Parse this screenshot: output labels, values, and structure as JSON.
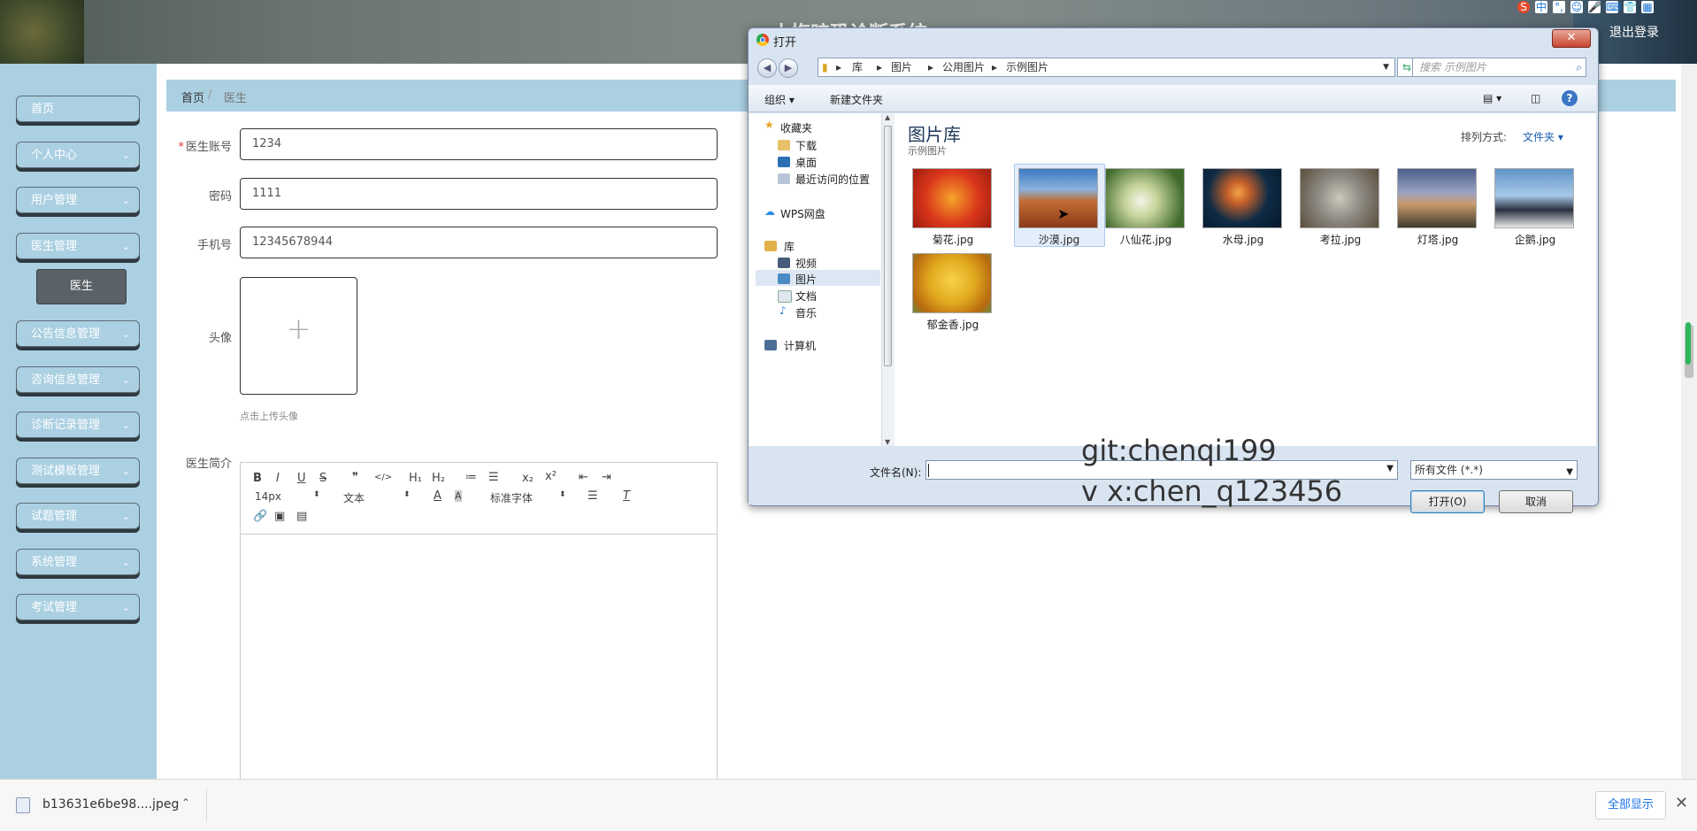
{
  "header": {
    "title": "小梅暗恐诊断系统",
    "logout": "退出登录",
    "ime_icons": [
      "S",
      "中",
      "°,",
      "☺",
      "🎤",
      "⌨",
      "👕",
      "▦"
    ]
  },
  "sidebar": {
    "items": [
      {
        "label": "首页",
        "has_chevron": false
      },
      {
        "label": "个人中心",
        "has_chevron": true
      },
      {
        "label": "用户管理",
        "has_chevron": true
      },
      {
        "label": "医生管理",
        "has_chevron": true
      },
      {
        "label": "公告信息管理",
        "has_chevron": true
      },
      {
        "label": "咨询信息管理",
        "has_chevron": true
      },
      {
        "label": "诊断记录管理",
        "has_chevron": true
      },
      {
        "label": "测试模板管理",
        "has_chevron": true
      },
      {
        "label": "试题管理",
        "has_chevron": true
      },
      {
        "label": "系统管理",
        "has_chevron": true
      },
      {
        "label": "考试管理",
        "has_chevron": true
      }
    ],
    "sub_item": "医生"
  },
  "breadcrumb": {
    "home": "首页",
    "separator": "/",
    "current": "医生"
  },
  "form": {
    "account_label": "医生账号",
    "account_required_mark": "*",
    "account_value": "1234",
    "password_label": "密码",
    "password_value": "1111",
    "phone_label": "手机号",
    "phone_value": "12345678944",
    "avatar_label": "头像",
    "upload_plus": "+",
    "upload_hint": "点击上传头像",
    "intro_label": "医生简介"
  },
  "editor": {
    "row1": [
      "B",
      "I",
      "U",
      "S",
      "❞",
      "</>",
      "H₁",
      "H₂",
      "≔",
      "☰",
      "x₂",
      "x²",
      "⇤",
      "⇥"
    ],
    "font_size": "14px",
    "text_type": "文本",
    "font_family": "标准字体",
    "row3_icons": [
      "link-icon",
      "image-icon",
      "video-icon"
    ]
  },
  "dialog": {
    "title": "打开",
    "close": "✕",
    "path": [
      "库",
      "图片",
      "公用图片",
      "示例图片"
    ],
    "search_placeholder": "搜索 示例图片",
    "organize": "组织 ▾",
    "new_folder": "新建文件夹",
    "tree": {
      "favorites": "收藏夹",
      "downloads": "下载",
      "desktop": "桌面",
      "recent": "最近访问的位置",
      "wps": "WPS网盘",
      "library": "库",
      "videos": "视频",
      "pictures": "图片",
      "documents": "文档",
      "music": "音乐",
      "computer": "计算机"
    },
    "library_title": "图片库",
    "library_sub": "示例图片",
    "arrange_label": "排列方式:",
    "arrange_value": "文件夹 ▾",
    "files": [
      {
        "name": "菊花.jpg",
        "color": "#d9361b"
      },
      {
        "name": "沙漠.jpg",
        "color": "#a34f2a"
      },
      {
        "name": "八仙花.jpg",
        "color": "#7d9a4c"
      },
      {
        "name": "水母.jpg",
        "color": "#15334d"
      },
      {
        "name": "考拉.jpg",
        "color": "#8d8a82"
      },
      {
        "name": "灯塔.jpg",
        "color": "#6a6e85"
      },
      {
        "name": "企鹅.jpg",
        "color": "#4d7fb0"
      },
      {
        "name": "郁金香.jpg",
        "color": "#e1a91e"
      }
    ],
    "filename_label": "文件名(N):",
    "filename_value": "",
    "filetype": "所有文件 (*.*)",
    "open_btn": "打开(O)",
    "cancel_btn": "取消"
  },
  "watermark": {
    "line1": "git:chenqi199",
    "line2": "v x:chen_q123456"
  },
  "download": {
    "filename": "b13631e6be98....jpeg",
    "show_all": "全部显示",
    "close": "✕"
  }
}
